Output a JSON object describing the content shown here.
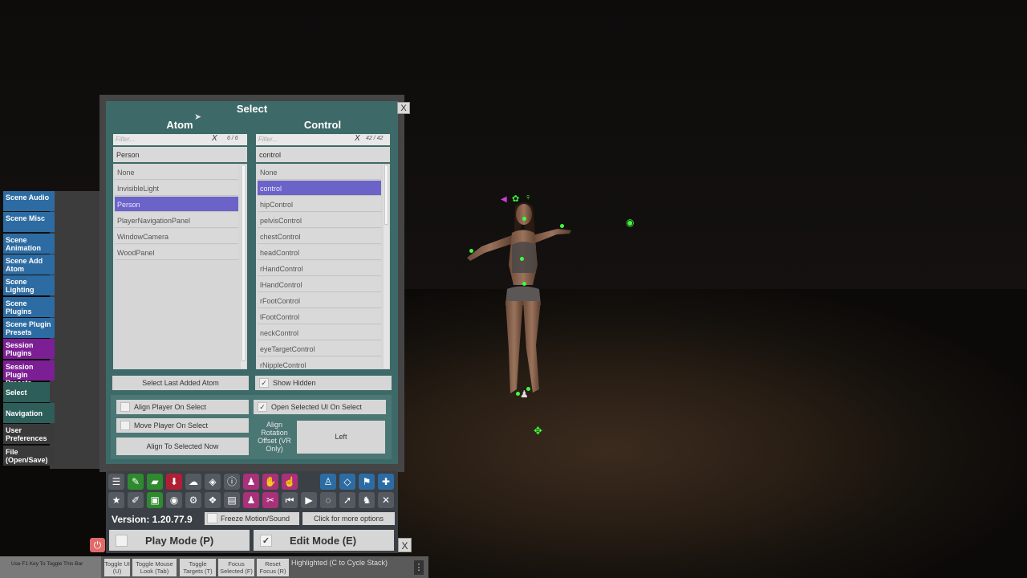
{
  "sidebar": {
    "items": [
      {
        "label": "Scene Audio"
      },
      {
        "label": "Scene Misc"
      },
      {
        "label": "Scene Animation"
      },
      {
        "label": "Scene Add Atom"
      },
      {
        "label": "Scene Lighting"
      },
      {
        "label": "Scene Plugins"
      },
      {
        "label": "Scene Plugin Presets"
      },
      {
        "label": "Session Plugins"
      },
      {
        "label": "Session Plugin Presets"
      },
      {
        "label": "Select"
      },
      {
        "label": "Navigation"
      },
      {
        "label": "User Preferences"
      },
      {
        "label": "File (Open/Save)"
      }
    ]
  },
  "panel": {
    "title": "Select",
    "close": "X",
    "atom": {
      "heading": "Atom",
      "filter_placeholder": "Filter...",
      "filter_clear": "X",
      "count": "6 / 6",
      "selected": "Person",
      "items": [
        "None",
        "InvisibleLight",
        "Person",
        "PlayerNavigationPanel",
        "WindowCamera",
        "WoodPanel"
      ]
    },
    "control": {
      "heading": "Control",
      "filter_placeholder": "Filter...",
      "filter_clear": "X",
      "count": "42 / 42",
      "selected": "control",
      "items": [
        "None",
        "control",
        "hipControl",
        "pelvisControl",
        "chestControl",
        "headControl",
        "rHandControl",
        "lHandControl",
        "rFootControl",
        "lFootControl",
        "neckControl",
        "eyeTargetControl",
        "rNippleControl"
      ]
    },
    "select_last_added": "Select Last Added Atom",
    "show_hidden": {
      "label": "Show Hidden",
      "checked": true
    },
    "align_player_on_select": {
      "label": "Align Player On Select",
      "checked": false
    },
    "open_selected_ui": {
      "label": "Open Selected UI On Select",
      "checked": true
    },
    "move_player_on_select": {
      "label": "Move Player On Select",
      "checked": false
    },
    "align_to_selected": "Align To Selected Now",
    "align_rotation_label": "Align Rotation Offset (VR Only)",
    "align_rotation_value": "Left"
  },
  "toolbar": {
    "version": "Version: 1.20.77.9",
    "freeze": {
      "label": "Freeze Motion/Sound",
      "checked": false
    },
    "more_options": "Click for more options",
    "play_mode": {
      "label": "Play Mode (P)",
      "checked": false
    },
    "edit_mode": {
      "label": "Edit Mode (E)",
      "checked": true
    },
    "close": "X",
    "check_glyph": "✓",
    "icons_row1": [
      "menu-icon",
      "edit-scene-icon",
      "open-folder-icon",
      "save-scene-icon",
      "cloud-download-icon",
      "package-icon",
      "info-icon",
      "person-settings-icon",
      "hand-icon",
      "touch-icon",
      "person-icon",
      "unity-icon",
      "flag-icon",
      "plus-icon"
    ],
    "icons_row2": [
      "star-icon",
      "edit-icon",
      "screenshot-icon",
      "camera-icon",
      "plugins-icon",
      "package-open-icon",
      "document-icon",
      "person-add-icon",
      "eraser-icon",
      "rewind-icon",
      "play-icon",
      "timer-icon",
      "pointer-icon",
      "group-icon",
      "tools-icon"
    ]
  },
  "bottom_bar": {
    "hint": "Use F1 Key To Toggle This Bar",
    "buttons": [
      "Toggle UI (U)",
      "Toggle Mouse Look (Tab)",
      "Toggle Targets (T)",
      "Focus Selected (F)",
      "Reset Focus (R)"
    ],
    "status": "Highlighted (C to Cycle Stack)",
    "menu": "⋮"
  }
}
